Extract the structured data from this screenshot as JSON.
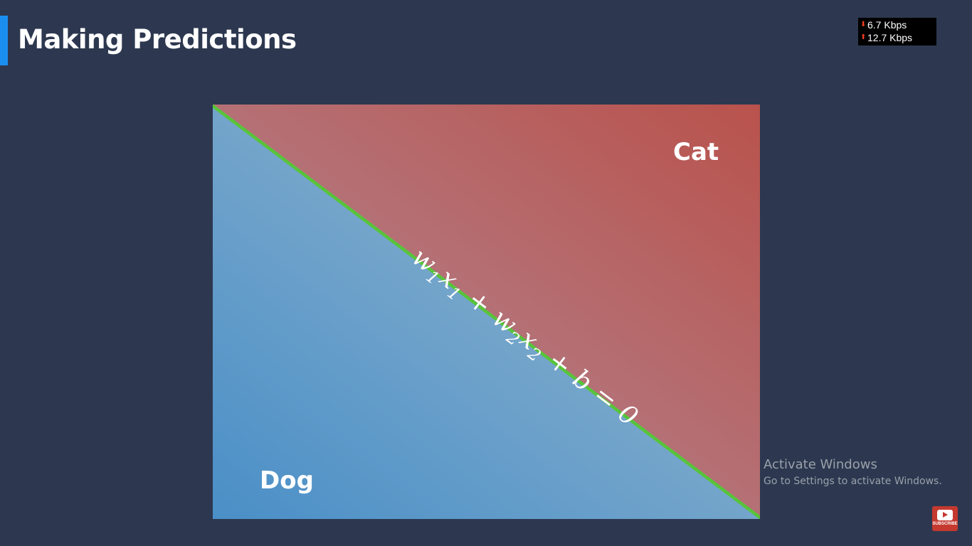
{
  "slide": {
    "title": "Making Predictions"
  },
  "network_monitor": {
    "download": "6.7 Kbps",
    "upload": "12.7 Kbps"
  },
  "diagram": {
    "regions": {
      "upper": "Cat",
      "lower": "Dog"
    },
    "boundary_equation": {
      "w1": "w",
      "s1": "1",
      "x1": "x",
      "s2": "1",
      "plus1": " + ",
      "w2": "w",
      "s3": "2",
      "x2": "x",
      "s4": "2",
      "plus2": " + ",
      "b": "b",
      "eq": " = ",
      "zero": "0"
    },
    "colors": {
      "cat": "#b9524c",
      "dog": "#4a8fc7",
      "boundary": "#57c43a"
    }
  },
  "watermark": {
    "line1": "Activate Windows",
    "line2": "Go to Settings to activate Windows."
  },
  "subscribe_badge": {
    "label": "SUBSCRIBE"
  }
}
